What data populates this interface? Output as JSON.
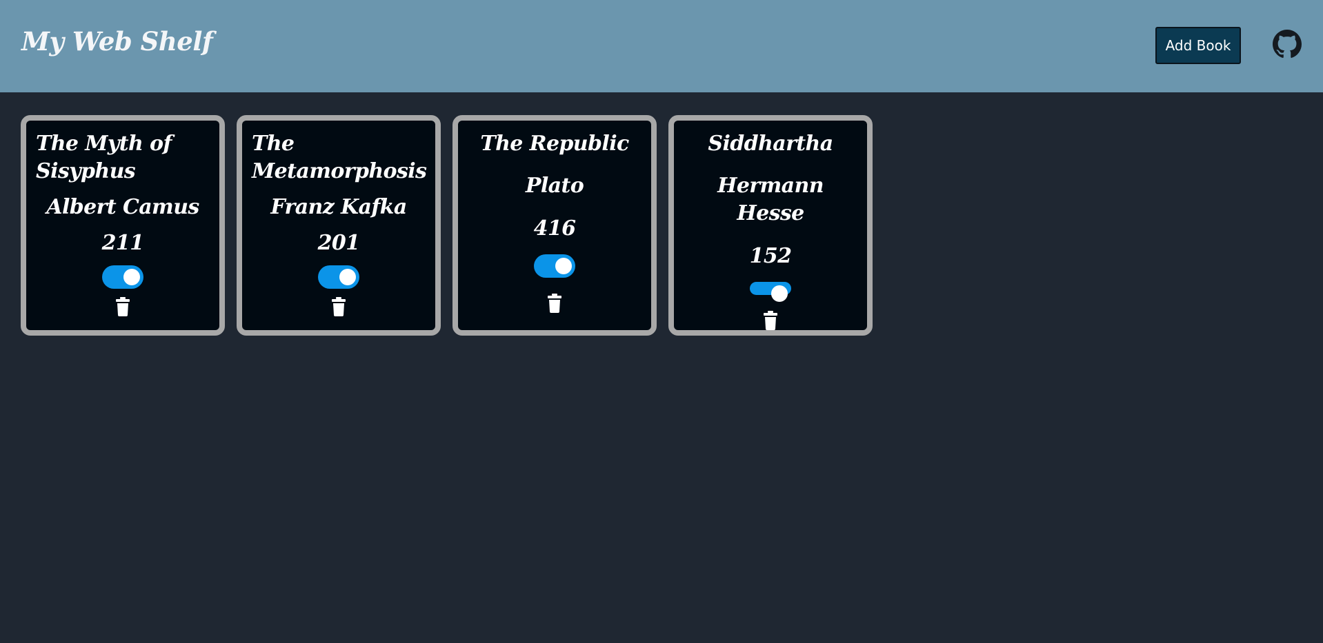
{
  "header": {
    "title": "My Web Shelf",
    "add_book_label": "Add Book",
    "github_icon": "github-icon"
  },
  "colors": {
    "header_bg": "#6b96ae",
    "page_bg": "#1f2732",
    "card_bg": "#010a12",
    "card_border": "#a8a8a8",
    "toggle_on": "#0b94e8",
    "button_bg": "#0b3a52"
  },
  "books": [
    {
      "title": "The Myth of Sisyphus",
      "author": "Albert Camus",
      "pages": "211",
      "read": true
    },
    {
      "title": "The Metamorphosis",
      "author": "Franz Kafka",
      "pages": "201",
      "read": true
    },
    {
      "title": "The Republic",
      "author": "Plato",
      "pages": "416",
      "read": true
    },
    {
      "title": "Siddhartha",
      "author": "Hermann Hesse",
      "pages": "152",
      "read": true
    }
  ]
}
